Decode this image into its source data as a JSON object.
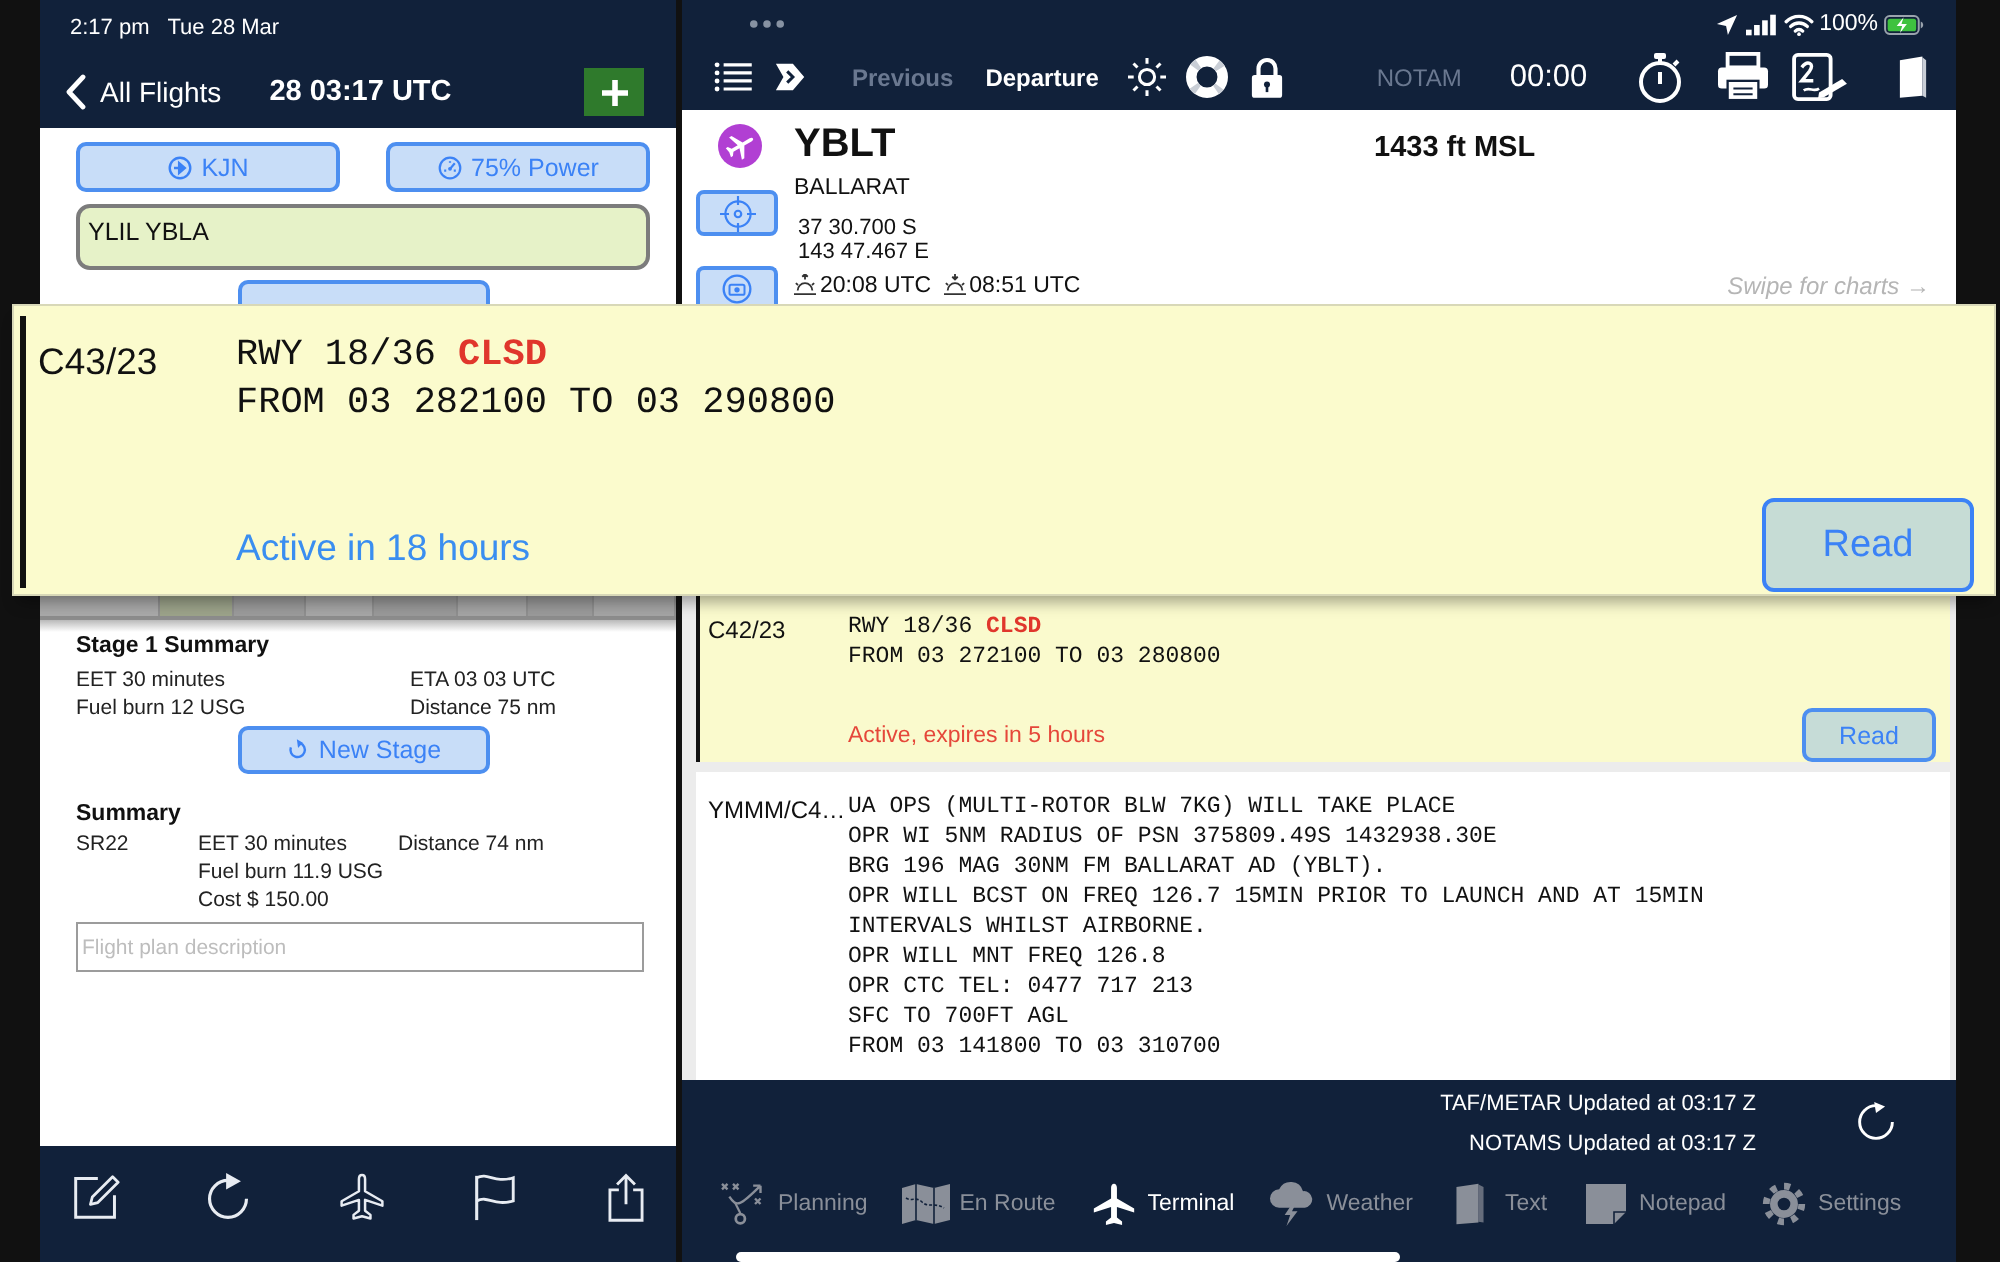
{
  "left_pane": {
    "status": {
      "time": "2:17 pm",
      "date": "Tue 28 Mar"
    },
    "nav": {
      "back_label": "All Flights",
      "title": "28 03:17 UTC"
    },
    "aircraft_button": "KJN",
    "power_button": "75% Power",
    "route_field": {
      "value": "YLIL YBLA"
    },
    "stage_summary": {
      "title": "Stage 1 Summary",
      "rows": [
        [
          "EET 30 minutes",
          "ETA 03 03 UTC"
        ],
        [
          "Fuel burn 12 USG",
          "Distance 75 nm"
        ]
      ]
    },
    "new_stage_button": "New Stage",
    "summary": {
      "title": "Summary",
      "aircraft": "SR22",
      "lines": [
        "EET 30 minutes",
        "Fuel burn 11.9 USG",
        "Cost $ 150.00"
      ],
      "distance": "Distance 74 nm"
    },
    "description_field": {
      "placeholder": "Flight plan description"
    }
  },
  "right_pane": {
    "status": {
      "battery": "100%"
    },
    "toolbar": {
      "previous": {
        "label": "Previous",
        "disabled": true
      },
      "current": {
        "label": "Departure",
        "disabled": false
      },
      "notam": {
        "label": "NOTAM",
        "disabled": true
      },
      "timer": "00:00"
    },
    "airport": {
      "code": "YBLT",
      "elevation": "1433 ft MSL",
      "name": "BALLARAT",
      "latitude": "37 30.700 S",
      "longitude": "143 47.467 E",
      "sunrise": "20:08 UTC",
      "sunset": "08:51 UTC",
      "swipe_hint": "Swipe for charts →"
    },
    "notams": [
      {
        "id": "C42/23",
        "highlighted": true,
        "text": "RWY 18/36 **CLSD**\nFROM 03 272100 TO 03 280800",
        "status": "Active, expires in 5 hours",
        "in_effect": true,
        "read_button": "Read"
      },
      {
        "id": "YMMM/C4…",
        "highlighted": false,
        "text": "UA OPS (MULTI-ROTOR BLW 7KG) WILL TAKE PLACE\nOPR WI 5NM RADIUS OF PSN 375809.49S 1432938.30E\nBRG 196 MAG 30NM FM BALLARAT AD (YBLT).\nOPR WILL BCST ON FREQ 126.7 15MIN PRIOR TO LAUNCH AND AT 15MIN\nINTERVALS WHILST AIRBORNE.\nOPR WILL MNT FREQ 126.8\nOPR CTC TEL: 0477 717 213\nSFC TO 700FT AGL\nFROM 03 141800 TO 03 310700"
      }
    ],
    "updates": [
      "TAF/METAR Updated at 03:17 Z",
      "NOTAMS Updated at 03:17 Z"
    ],
    "tabs": [
      {
        "label": "Planning",
        "selected": false
      },
      {
        "label": "En Route",
        "selected": false
      },
      {
        "label": "Terminal",
        "selected": true
      },
      {
        "label": "Weather",
        "selected": false
      },
      {
        "label": "Text",
        "selected": false
      },
      {
        "label": "Notepad",
        "selected": false
      },
      {
        "label": "Settings",
        "selected": false
      }
    ]
  },
  "notam_popup": {
    "id": "C43/23",
    "text": "RWY 18/36 **CLSD**\nFROM 03 282100 TO 03 290800",
    "status": "Active in 18 hours",
    "in_effect": false,
    "read_button": "Read"
  }
}
